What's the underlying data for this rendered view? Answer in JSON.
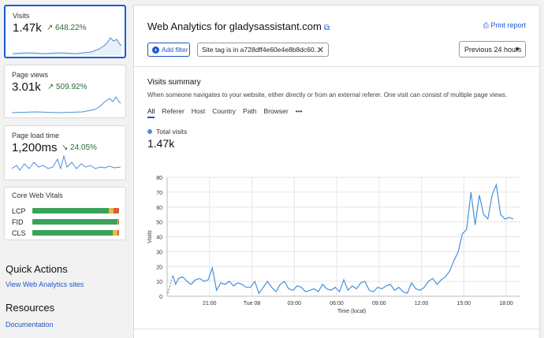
{
  "sidebar": {
    "cards": [
      {
        "label": "Visits",
        "value": "1.47k",
        "arrow": "↗",
        "change": "648.22%"
      },
      {
        "label": "Page views",
        "value": "3.01k",
        "arrow": "↗",
        "change": "509.92%"
      },
      {
        "label": "Page load time",
        "value": "1,200ms",
        "arrow": "↘",
        "change": "24.05%"
      }
    ],
    "cwv": {
      "title": "Core Web Vitals",
      "rows": [
        {
          "label": "LCP",
          "good": 0.88,
          "ni": 0.06,
          "poor": 0.06
        },
        {
          "label": "FID",
          "good": 0.98,
          "ni": 0.01,
          "poor": 0.01
        },
        {
          "label": "CLS",
          "good": 0.93,
          "ni": 0.05,
          "poor": 0.02
        }
      ]
    },
    "quick_actions": {
      "title": "Quick Actions",
      "link": "View Web Analytics sites"
    },
    "resources": {
      "title": "Resources",
      "link": "Documentation"
    }
  },
  "main": {
    "title": "Web Analytics for gladysassistant.com",
    "print_label": "Print report",
    "add_filter_label": "Add filter",
    "filter_chip": "Site tag is in a728dff4e60e4e8b8dc60...",
    "period": "Previous 24 hours",
    "summary_title": "Visits summary",
    "summary_desc": "When someone navigates to your website, either directly or from an external referer. One visit can consist of multiple page views.",
    "tabs": [
      "All",
      "Referer",
      "Host",
      "Country",
      "Path",
      "Browser",
      "•••"
    ],
    "legend_label": "Total visits",
    "total": "1.47k"
  },
  "colors": {
    "accent": "#1e56c9",
    "line": "#4a90d9",
    "good": "#3aa35a",
    "ni": "#f0b548",
    "poor": "#e05a3c"
  },
  "chart_data": {
    "type": "line",
    "ylabel": "Visits",
    "xlabel": "Time (local)",
    "ylim": [
      0,
      80
    ],
    "yticks": [
      0,
      10,
      20,
      30,
      40,
      50,
      60,
      70,
      80
    ],
    "xticks": [
      "21:00",
      "Tue 08",
      "03:00",
      "06:00",
      "09:00",
      "12:00",
      "15:00",
      "18:00"
    ],
    "x_hours": [
      18.4,
      18.6,
      18.8,
      19.1,
      19.4,
      19.7,
      20.0,
      20.3,
      20.6,
      20.9,
      21.2,
      21.5,
      21.8,
      22.1,
      22.4,
      22.7,
      23.0,
      23.3,
      23.6,
      23.9,
      24.2,
      24.5,
      24.8,
      25.1,
      25.4,
      25.7,
      26.0,
      26.3,
      26.6,
      26.9,
      27.2,
      27.5,
      27.8,
      28.1,
      28.4,
      28.7,
      29.0,
      29.3,
      29.6,
      29.9,
      30.2,
      30.5,
      30.8,
      31.1,
      31.4,
      31.7,
      32.0,
      32.3,
      32.6,
      32.9,
      33.2,
      33.5,
      33.8,
      34.1,
      34.4,
      34.7,
      35.0,
      35.3,
      35.6,
      35.9,
      36.2,
      36.5,
      36.8,
      37.1,
      37.4,
      37.7,
      38.0,
      38.3,
      38.6,
      38.9,
      39.2,
      39.5,
      39.8,
      40.1,
      40.4,
      40.7,
      41.0,
      41.3,
      41.6,
      41.9,
      42.2,
      42.5
    ],
    "values": [
      14,
      8,
      12,
      13,
      10,
      8,
      11,
      12,
      10,
      11,
      19,
      4,
      9,
      8,
      10,
      7,
      9,
      8,
      6,
      6,
      10,
      2,
      6,
      10,
      6,
      3,
      8,
      10,
      5,
      4,
      7,
      6,
      3,
      4,
      5,
      3,
      8,
      5,
      4,
      6,
      3,
      11,
      4,
      7,
      5,
      9,
      10,
      4,
      3,
      6,
      5,
      7,
      8,
      4,
      6,
      3,
      2,
      9,
      5,
      4,
      6,
      10,
      12,
      8,
      11,
      13,
      17,
      24,
      30,
      42,
      45,
      70,
      48,
      68,
      55,
      52,
      68,
      75,
      55,
      52,
      53,
      52
    ],
    "dashed_start": {
      "x_hours": 18.05,
      "value": 2
    }
  }
}
